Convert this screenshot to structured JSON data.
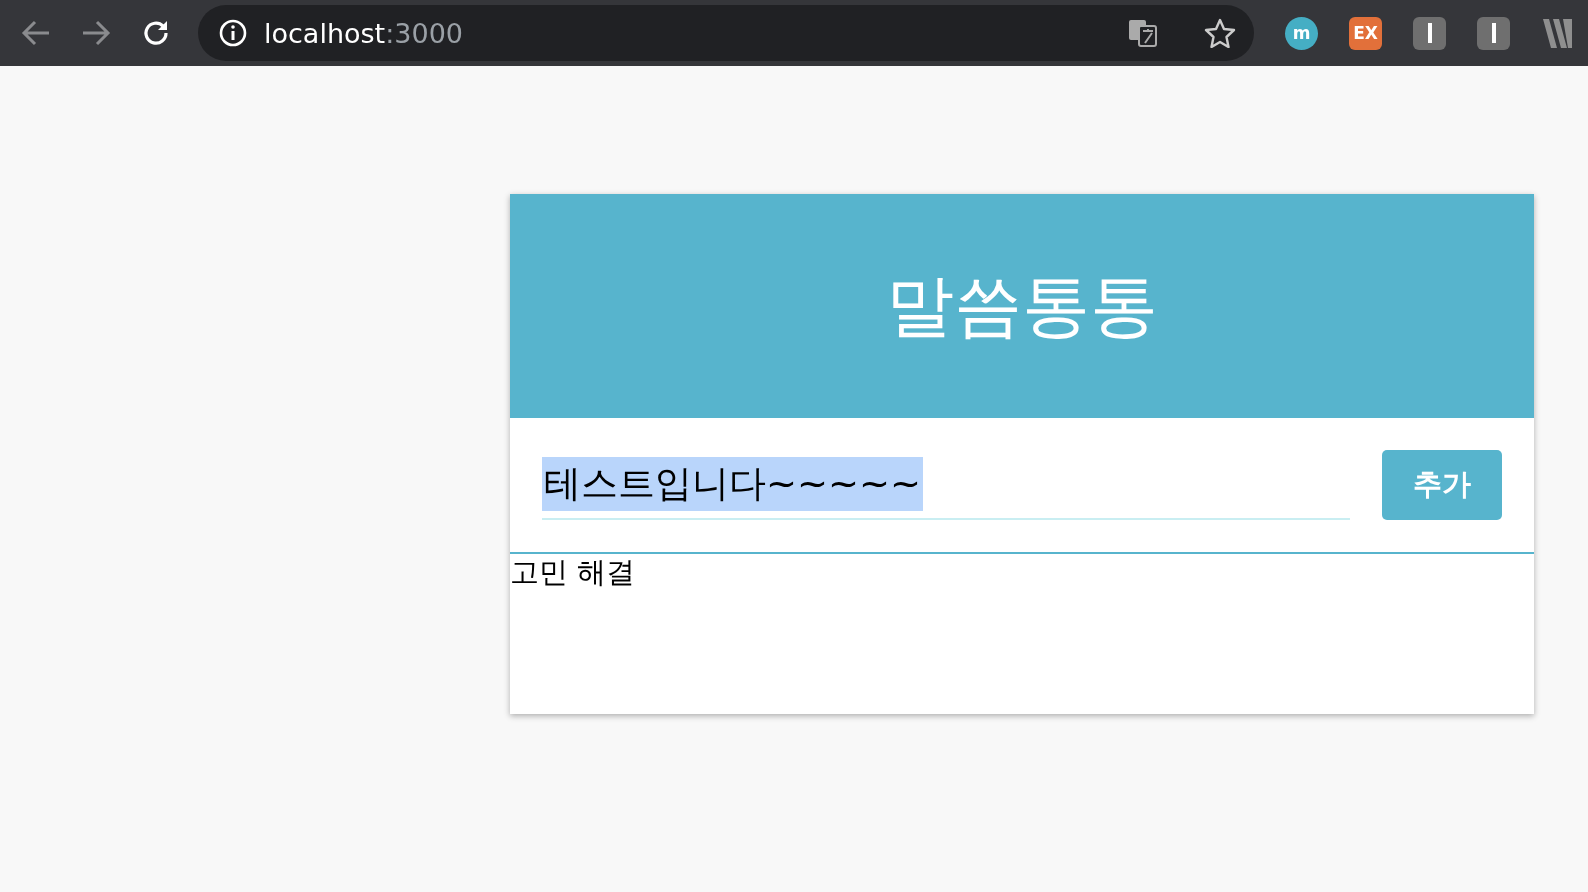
{
  "browser": {
    "address_host": "localhost",
    "address_port": ":3000",
    "extensions": [
      {
        "kind": "text",
        "label": "m",
        "color": "#45aec4"
      },
      {
        "kind": "text",
        "label": "EX",
        "color": "#e2703a"
      },
      {
        "kind": "bar"
      },
      {
        "kind": "bar"
      },
      {
        "kind": "stripes"
      }
    ]
  },
  "app": {
    "title": "말씀통통",
    "input": {
      "value": "테스트입니다~~~~~",
      "text_selected": true
    },
    "add_button": "추가",
    "items": [
      "고민 해결"
    ]
  }
}
